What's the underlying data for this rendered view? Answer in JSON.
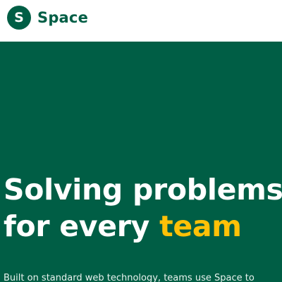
{
  "header": {
    "logo_letter": "S",
    "brand_name": "Space",
    "brand_color": "#005e45"
  },
  "hero": {
    "headline_line1": "Solving problems",
    "headline_line2_prefix": "for every ",
    "headline_highlight": "team",
    "description": "Built on standard web technology, teams use Space to",
    "background_color": "#005e45",
    "highlight_color": "#ffc107"
  }
}
